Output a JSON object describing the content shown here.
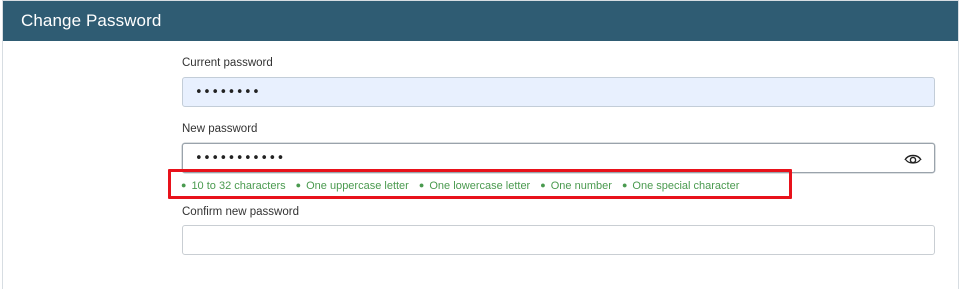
{
  "header": {
    "title": "Change Password"
  },
  "current_password": {
    "label": "Current password",
    "masked_value": "••••••••"
  },
  "new_password": {
    "label": "New password",
    "masked_value": "•••••••••••",
    "toggle_icon": "eye-icon"
  },
  "requirements": [
    "10 to 32 characters",
    "One uppercase letter",
    "One lowercase letter",
    "One number",
    "One special character"
  ],
  "confirm_password": {
    "label": "Confirm new password",
    "value": ""
  },
  "colors": {
    "header_bg": "#2f5c73",
    "requirement_text": "#4a9a4f",
    "highlight_border": "#e8121b"
  }
}
